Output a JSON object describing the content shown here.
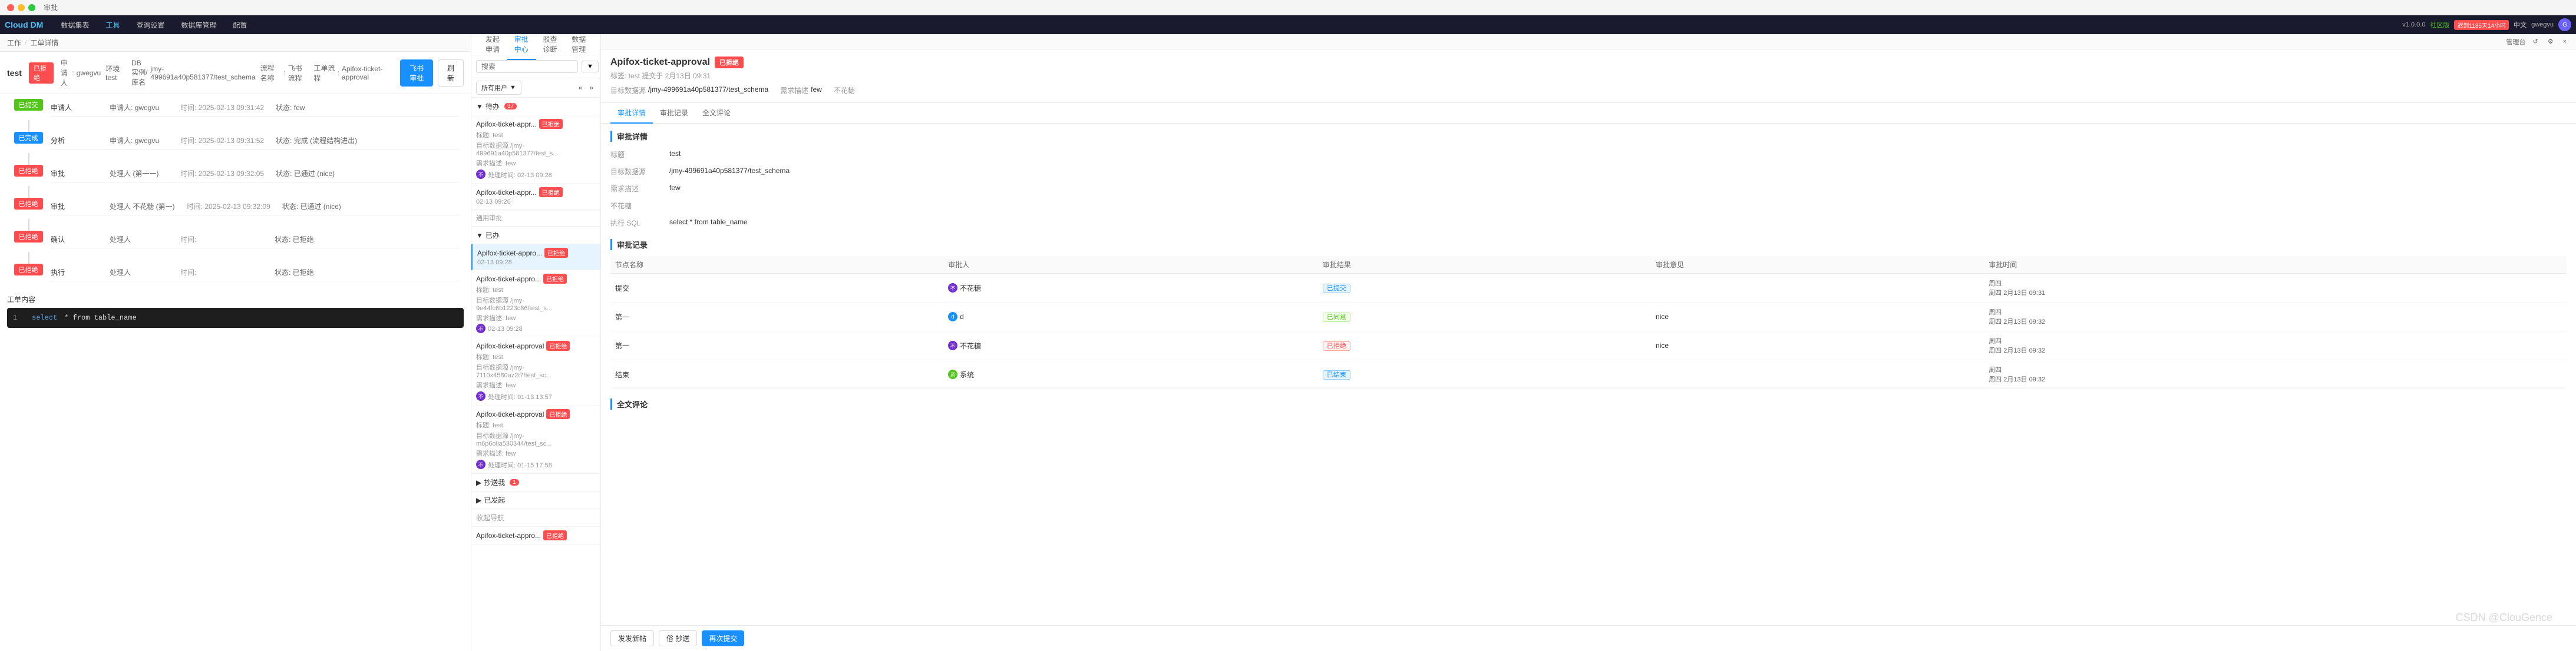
{
  "window": {
    "dots": [
      "red",
      "yellow",
      "green"
    ],
    "title": "审批"
  },
  "topNav": {
    "logo": "Cloud DM",
    "items": [
      "数据集表",
      "工具",
      "查询设置",
      "数据库管理",
      "配置"
    ],
    "version": "v1.0.0.0",
    "community": "社区版",
    "alert_label": "迟到1185天14小时",
    "lang": "中文",
    "user": "gwegvu"
  },
  "breadcrumb": {
    "items": [
      "工作",
      "工单详情"
    ]
  },
  "workitem": {
    "id": "test",
    "status": "已拒绝",
    "submitter_label": "申请人",
    "submitter": "gwegvu",
    "test_label": "环境 test",
    "db_label": "DB实例/库名",
    "db_value": "jmy-499691a40p581377/test_schema",
    "flow_label": "流程名称",
    "flow_value": "飞书流程",
    "workflow_label": "工单流程",
    "workflow_value": "Apifox-ticket-approval",
    "btn_history": "飞书审批",
    "btn_refresh": "刷新"
  },
  "timeline": [
    {
      "node": "已提交",
      "node_color": "green",
      "label": "申请人",
      "person": "申请人: gwegvu",
      "time": "时间: 2025-02-13 09:31:42",
      "status": "状态: few",
      "note": ""
    },
    {
      "node": "已完成",
      "node_color": "blue",
      "label": "分析",
      "person": "申请人: gwegvu",
      "time": "时间: 2025-02-13 09:31:52",
      "status": "状态: 完成 (流程结构进出)",
      "note": ""
    },
    {
      "node": "已拒绝",
      "node_color": "red",
      "label": "审批",
      "person": "处理人 (第一一)",
      "time": "时间: 2025-02-13 09:32:05",
      "status": "状态: 已通过 (nice)",
      "note": ""
    },
    {
      "node": "已拒绝",
      "node_color": "red",
      "label": "审批",
      "person": "处理人 不花糖 (第一)",
      "time": "时间: 2025-02-13 09:32:09",
      "status": "状态: 已通过 (nice)",
      "note": ""
    },
    {
      "node": "已拒绝",
      "node_color": "red",
      "label": "确认",
      "person": "处理人",
      "time": "时间:",
      "status": "状态: 已拒绝",
      "note": ""
    },
    {
      "node": "已拒绝",
      "node_color": "red",
      "label": "执行",
      "person": "处理人",
      "time": "时间:",
      "status": "状态: 已拒绝",
      "note": ""
    }
  ],
  "workContent": {
    "title": "工单内容",
    "sql_line_num": "1",
    "sql": "select * from table_name"
  },
  "approvalCenter": {
    "search_placeholder": "搜索",
    "filter_label": "所有用户",
    "filter_icon": "▼",
    "pagination": "«  »",
    "sections": {
      "todo": {
        "label": "待办",
        "count": "37",
        "items": [
          {
            "title": "Apifox-ticket-appr...",
            "badge": "已拒绝",
            "badge_color": "red",
            "meta1": "标题: test",
            "meta2": "目标数据源 /jmy-499691a40p581377/test_s...",
            "meta3": "需求描述: few",
            "submitter": "不花糖",
            "time": "处理时间: 02-13 09:28",
            "avatar_color": "purple"
          },
          {
            "title": "Apifox-ticket-appr...",
            "badge": "已拒绝",
            "badge_color": "red",
            "meta1": "",
            "meta2": "",
            "meta3": "",
            "submitter": "",
            "time": "02-13 09:26",
            "avatar_color": "purple"
          }
        ]
      },
      "doing": {
        "label": "已办",
        "count": "",
        "items": [
          {
            "title": "Apifox-ticket-appro...",
            "badge": "已拒绝",
            "badge_color": "red",
            "meta1": "",
            "meta2": "",
            "meta3": "",
            "submitter": "",
            "time": "02-13 09:28",
            "avatar_color": "purple",
            "active": true
          },
          {
            "title": "Apifox-ticket-appro...",
            "badge": "已拒绝",
            "badge_color": "red",
            "meta1": "标题: test",
            "meta2": "目标数据源 /jmy-9e44fc6b1223c86/test_s...",
            "meta3": "需求描述: few",
            "submitter": "不花糖",
            "time": "02-13 09:28",
            "avatar_color": "purple"
          }
        ]
      },
      "reply": {
        "label": "抄送我",
        "count": "1",
        "items": []
      },
      "sent": {
        "label": "已发起",
        "count": "",
        "items": []
      }
    }
  },
  "approvalDetail": {
    "title": "Apifox-ticket-approval",
    "badge": "已拒绝",
    "subtitle": "标签: test  提交于 2月13日 09:31",
    "meta": [
      {
        "label": "目标数据源",
        "value": "/jmy-499691a40p581377/test_schema"
      },
      {
        "label": "需求描述",
        "value": "few"
      },
      {
        "label": "不花糖",
        "value": ""
      }
    ],
    "tabs": [
      "审批详情",
      "审批记录",
      "全文评论"
    ],
    "active_tab": "审批详情",
    "detail": {
      "title": "审批详情",
      "fields": [
        {
          "label": "标题",
          "value": "test"
        },
        {
          "label": "目标数据源",
          "value": "/jmy-499691a40p581377/test_schema"
        },
        {
          "label": "需求描述",
          "value": "few"
        },
        {
          "label": "不花糖",
          "value": ""
        },
        {
          "label": "执行 SQL",
          "value": "select * from table_name"
        }
      ]
    },
    "log": {
      "title": "审批记录",
      "columns": [
        "节点名称",
        "审批人",
        "审批结果",
        "审批意见",
        "审批时间"
      ],
      "rows": [
        {
          "node": "提交",
          "approver_name": "不花糖",
          "approver_avatar": "purple",
          "result": "已提交",
          "result_type": "submitted",
          "opinion": "",
          "time": "周四\n2月13日 09:31"
        },
        {
          "node": "第一",
          "approver_name": "d",
          "approver_avatar": "blue",
          "result": "已同意",
          "result_type": "approved",
          "opinion": "nice",
          "time": "周四\n2月13日 09:32"
        },
        {
          "node": "第一",
          "approver_name": "不花糖",
          "approver_avatar": "purple",
          "result": "已拒绝",
          "result_type": "rejected",
          "opinion": "nice",
          "time": "周四\n2月13日 09:32"
        },
        {
          "node": "结束",
          "approver_name": "系统",
          "approver_avatar": "green",
          "result": "已结束",
          "result_type": "submitted",
          "opinion": "",
          "time": "周四\n2月13日 09:32"
        }
      ]
    },
    "comment": {
      "title": "全文评论",
      "actions": [
        "发发新帖",
        "俗 抄送",
        "再次提交"
      ]
    }
  },
  "approvalWindow": {
    "title": "审批",
    "toolbar": {
      "management": "管理台",
      "refresh": "↺",
      "settings": "⚙",
      "close": "×"
    },
    "tabs": [
      "发起申请",
      "审批中心",
      "驳查诊断",
      "数据管理"
    ],
    "active_tab": "审批中心"
  },
  "additionalCards": [
    {
      "title": "Apifox-ticket-approval",
      "badge": "已拒绝",
      "meta1": "标题: test",
      "meta2": "目标数据源 /jmy-7110x4580az2t7/test_sc...",
      "meta3": "需求描述: few",
      "submitter": "不花糖",
      "time": "处理时间: 01-13 13:57"
    },
    {
      "title": "Apifox-ticket-approval",
      "badge": "已拒绝",
      "meta1": "标题: test",
      "meta2": "目标数据源 /jmy-m6p6olia530344/test_sc...",
      "meta3": "需求描述: few",
      "submitter": "不花糖",
      "time": "处理时间: 01-15 17:58"
    },
    {
      "title": "Apifox-ticket-appro...",
      "badge": "已拒绝",
      "meta1": "",
      "meta2": "",
      "meta3": "",
      "submitter": "",
      "time": ""
    }
  ],
  "sectionHeaders": {
    "copy_to_me": "抄送我",
    "copy_count": "1",
    "sent_label": "已发起",
    "collect_label": "收起导航"
  },
  "icons": {
    "triangle_right": "▶",
    "triangle_down": "▼",
    "search": "🔍",
    "edit": "✏",
    "link": "🔗",
    "share": "↗"
  }
}
